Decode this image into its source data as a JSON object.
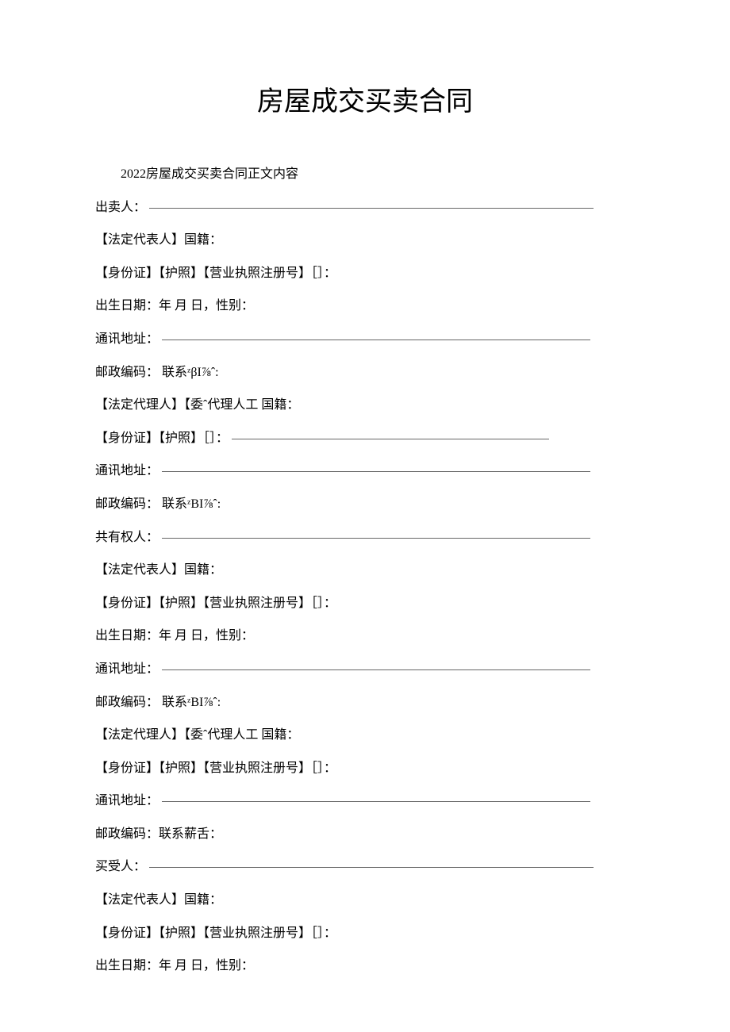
{
  "title": "房屋成交买卖合同",
  "subtitle": "2022房屋成交买卖合同正文内容",
  "lines": {
    "seller": "出卖人：",
    "legal_rep_nat": "【法定代表人】国籍：",
    "id_passport_reg": "【身份证】【护照】【营业执照注册号】［］：",
    "id_passport": "【身份证】【护照】［］：",
    "birth_gender": "出生日期：年 月 日，性别：",
    "address": "通讯地址：",
    "postal_contact_1": "邮政编码：   联系ᶻβI⅞ˆ:",
    "postal_contact_2": "邮政编码：   联系ᶻBI⅞ˆ:",
    "postal_contact_3": "邮政编码：   联系ᶻBI⅞ˆ:",
    "postal_contact_4": "邮政编码：联系薪舌：",
    "legal_agent_nat": "【法定代理人】【委ˆ代理人工 国籍：",
    "coowner": "共有权人：",
    "buyer": "买受人："
  }
}
